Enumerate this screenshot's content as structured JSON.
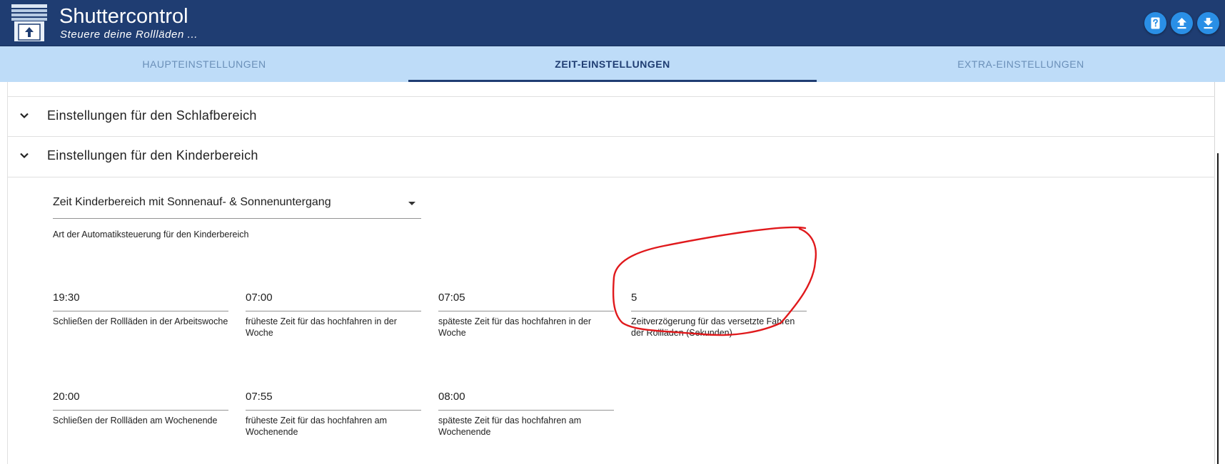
{
  "app": {
    "title": "Shuttercontrol",
    "subtitle": "Steuere deine Rollläden ..."
  },
  "header_buttons": [
    {
      "name": "help",
      "icon": "help-book-icon"
    },
    {
      "name": "upload",
      "icon": "upload-icon"
    },
    {
      "name": "download",
      "icon": "download-icon"
    }
  ],
  "tabs": [
    {
      "label": "HAUPTEINSTELLUNGEN",
      "active": false
    },
    {
      "label": "ZEIT-EINSTELLUNGEN",
      "active": true
    },
    {
      "label": "EXTRA-EINSTELLUNGEN",
      "active": false
    }
  ],
  "sections": {
    "schlafbereich": {
      "title": "Einstellungen für den Schlafbereich",
      "expanded": false
    },
    "kinderbereich": {
      "title": "Einstellungen für den Kinderbereich",
      "expanded": true
    }
  },
  "kinderbereich": {
    "mode_select": {
      "value": "Zeit Kinderbereich mit Sonnenauf- & Sonnenuntergang",
      "helper": "Art der Automatiksteuerung für den Kinderbereich"
    },
    "week_fields": [
      {
        "value": "19:30",
        "helper": "Schließen der Rollläden in der Arbeitswoche"
      },
      {
        "value": "07:00",
        "helper": "früheste Zeit für das hochfahren in der Woche"
      },
      {
        "value": "07:05",
        "helper": "späteste Zeit für das hochfahren in der Woche"
      },
      {
        "value": "5",
        "helper": "Zeitverzögerung für das versetzte Fahren der Rollläden (Sekunden)"
      }
    ],
    "weekend_fields": [
      {
        "value": "20:00",
        "helper": "Schließen der Rollläden am Wochenende"
      },
      {
        "value": "07:55",
        "helper": "früheste Zeit für das hochfahren am Wochenende"
      },
      {
        "value": "08:00",
        "helper": "späteste Zeit für das hochfahren am Wochenende"
      }
    ]
  },
  "colors": {
    "header_bg": "#1f3d72",
    "tab_bar_bg": "#bedcf8",
    "accent_button": "#2a8fe6",
    "annotation_circle": "#e0191c"
  }
}
